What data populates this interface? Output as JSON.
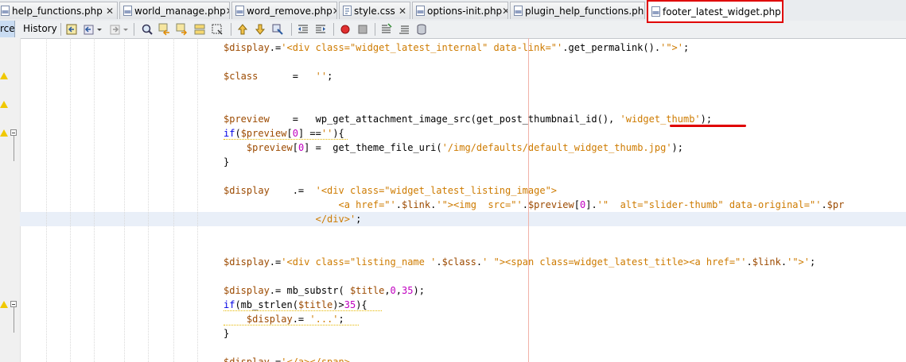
{
  "tabs": [
    {
      "label": "help_functions.php",
      "type": "php",
      "active": false
    },
    {
      "label": "world_manage.php",
      "type": "php",
      "active": false
    },
    {
      "label": "word_remove.php",
      "type": "php",
      "active": false
    },
    {
      "label": "style.css",
      "type": "css",
      "active": false
    },
    {
      "label": "options-init.php",
      "type": "php",
      "active": false
    },
    {
      "label": "plugin_help_functions.php",
      "type": "php",
      "active": false
    },
    {
      "label": "footer_latest_widget.php",
      "type": "php",
      "active": true
    }
  ],
  "toolbar": {
    "source_label": "rce",
    "history_label": "History"
  },
  "editor": {
    "highlight_color": "#e9eff8",
    "warning_color": "#f0c800",
    "annotation_color": "#e00000",
    "lines": {
      "l1": "$display.='<div class=\"widget_latest_internal\" data-link=\"'.get_permalink().'\">';",
      "l2": "$class      =   '';",
      "l3": "$preview    =   wp_get_attachment_image_src(get_post_thumbnail_id(), 'widget_thumb');",
      "l4": "if($preview[0] =='){",
      "l5": "    $preview[0] =  get_theme_file_uri('/img/defaults/default_widget_thumb.jpg');",
      "l6": "}",
      "l7": "$display    .=  '<div class=\"widget_latest_listing_image\">",
      "l8": "                    <a href=\"'.$link.'\"><img  src=\"'.$preview[0].'\"  alt=\"slider-thumb\" data-original=\"'.$pr",
      "l9": "                </div>';",
      "l10": "$display.='<div class=\"listing_name '.$class.' \"><span class=widget_latest_title><a href=\"'.$link.'\">';",
      "l11": "$display.= mb_substr( $title,0,35);",
      "l12": "if(mb_strlen($title)>35){",
      "l13": "    $display.= '...';",
      "l14": "}",
      "l15": "$display.='</a></span>"
    }
  }
}
